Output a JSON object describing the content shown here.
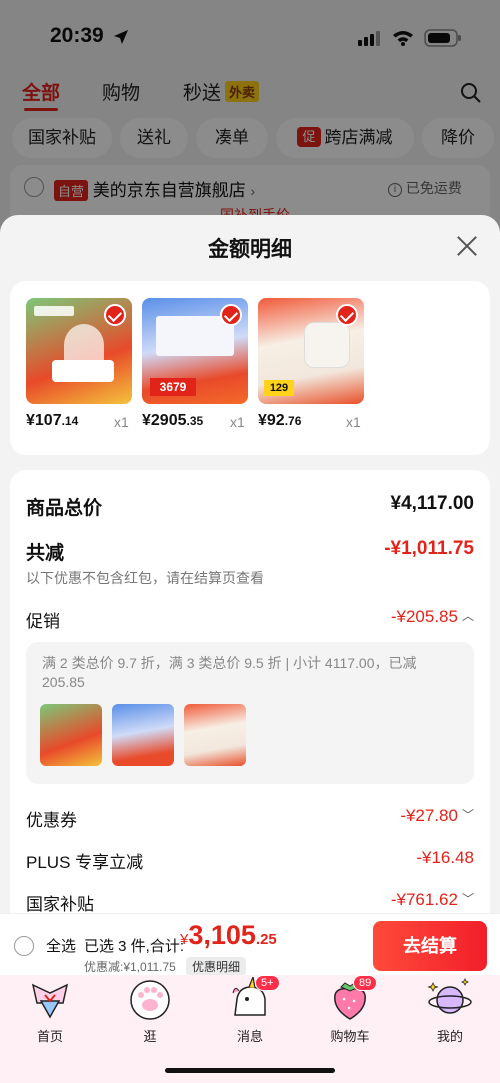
{
  "status_bar": {
    "time": "20:39"
  },
  "background": {
    "tabs": [
      "全部",
      "购物",
      "秒送"
    ],
    "waimai_tag": "外卖",
    "chips": [
      "国家补贴",
      "送礼",
      "凑单",
      "跨店满减",
      "降价"
    ],
    "promo_tag": "促",
    "store": {
      "tag": "自营",
      "name": "美的京东自营旗舰店",
      "free_shipping": "已免运费",
      "partial_text": "国补到手价"
    }
  },
  "modal": {
    "title": "金额明细",
    "products": [
      {
        "price_main": "¥107",
        "price_cents": ".14",
        "qty": "x1"
      },
      {
        "price_main": "¥2905",
        "price_cents": ".35",
        "qty": "x1"
      },
      {
        "price_main": "¥92",
        "price_cents": ".76",
        "qty": "x1"
      }
    ],
    "summary": {
      "total_label": "商品总价",
      "total_value": "¥4,117.00",
      "reduce_label": "共减",
      "reduce_value": "-¥1,011.75",
      "hint": "以下优惠不包含红包，请在结算页查看",
      "promo_label": "促销",
      "promo_value": "-¥205.85",
      "promo_desc": "满 2 类总价 9.7 折，满 3 类总价 9.5 折 | 小计 4117.00，已减 205.85",
      "coupon_label": "优惠券",
      "coupon_value": "-¥27.80",
      "plus_label": "PLUS 专享立减",
      "plus_value": "-¥16.48",
      "subsidy_label": "国家补贴",
      "subsidy_value": "-¥761.62"
    }
  },
  "checkout": {
    "select_all": "全选",
    "selected": "已选 3 件,合计:",
    "currency": "¥",
    "amount_main": "3,105",
    "amount_cents": ".25",
    "discount": "优惠减:¥1,011.75",
    "detail_chip": "优惠明细",
    "button": "去结算"
  },
  "tabbar": {
    "items": [
      {
        "label": "首页",
        "icon": "home-sailor-icon"
      },
      {
        "label": "逛",
        "icon": "paw-icon"
      },
      {
        "label": "消息",
        "icon": "unicorn-icon",
        "badge": "5+"
      },
      {
        "label": "购物车",
        "icon": "strawberry-icon",
        "badge": "89"
      },
      {
        "label": "我的",
        "icon": "planet-icon"
      }
    ]
  },
  "colors": {
    "accent": "#e2231a",
    "tabbar_bg": "#fff0f6"
  }
}
